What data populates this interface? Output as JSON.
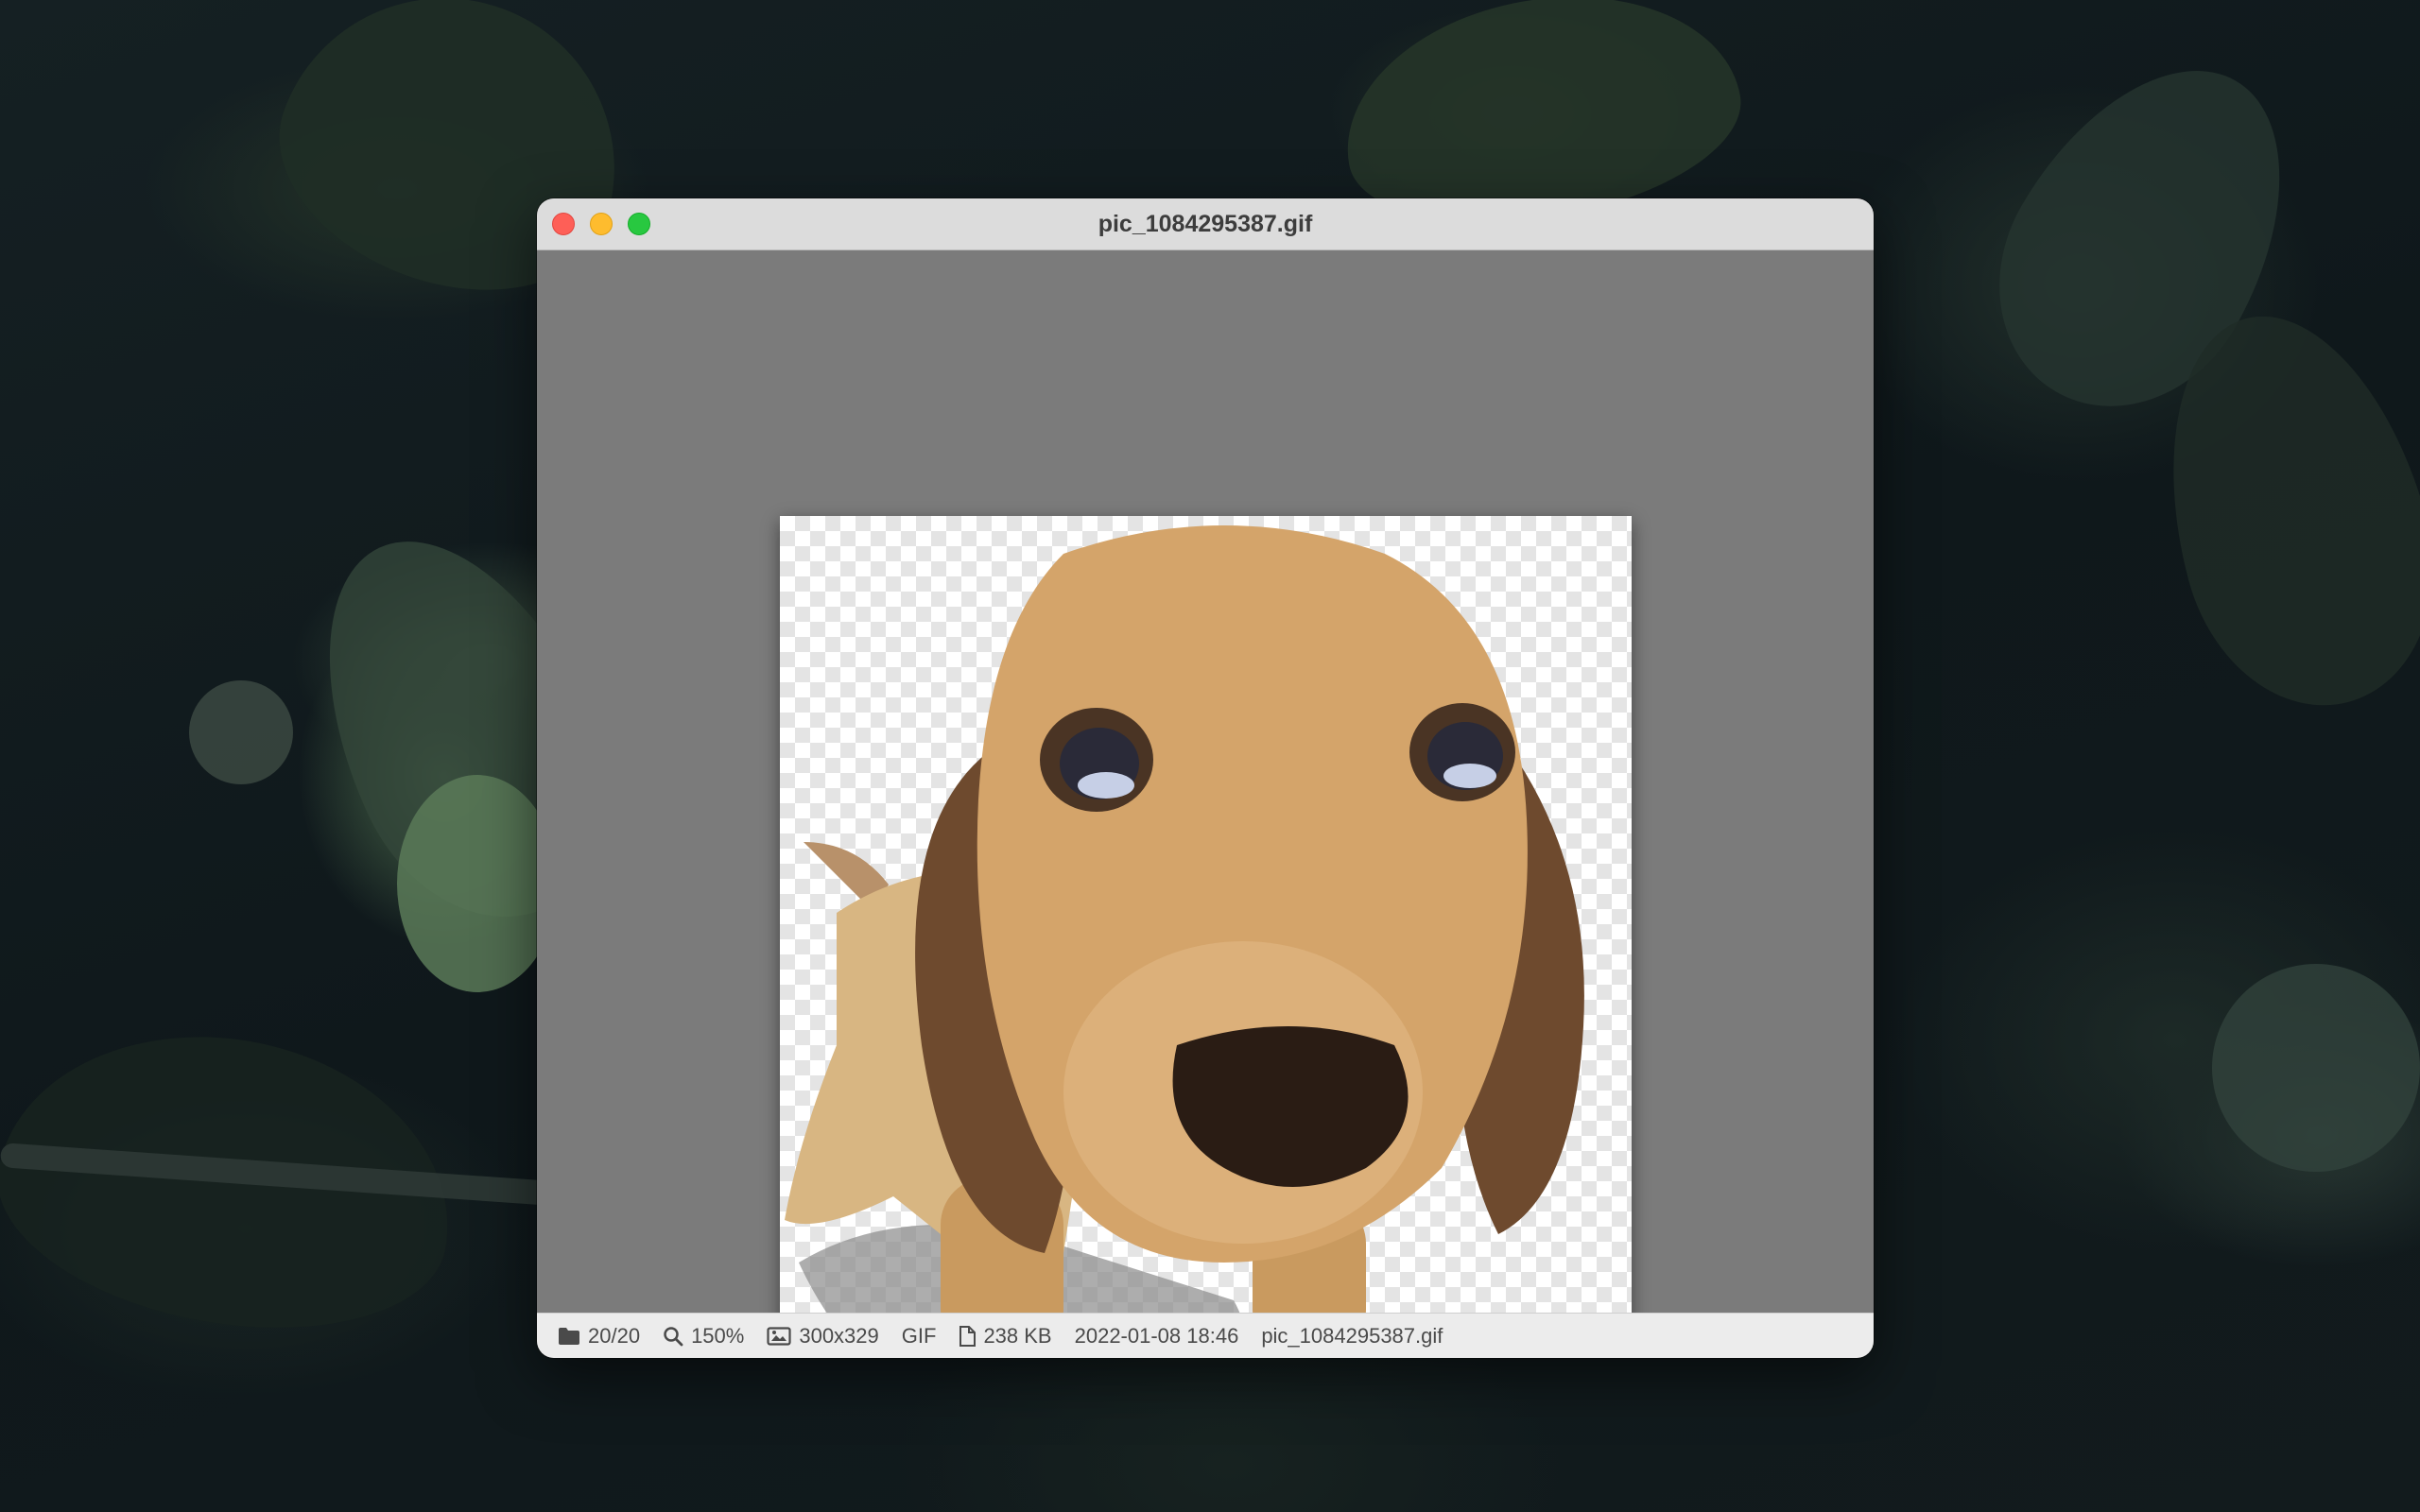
{
  "window": {
    "title": "pic_1084295387.gif"
  },
  "statusbar": {
    "position": "20/20",
    "zoom": "150%",
    "dimensions": "300x329",
    "format": "GIF",
    "filesize": "238 KB",
    "datetime": "2022-01-08 18:46",
    "filename": "pic_1084295387.gif"
  },
  "icons": {
    "position": "folder-icon",
    "zoom": "magnifier-icon",
    "dimensions": "image-icon",
    "filesize": "document-icon"
  },
  "colors": {
    "close": "#fe5f57",
    "minimize": "#febc2e",
    "maximize": "#28c840",
    "viewer_background": "#7b7b7b"
  }
}
